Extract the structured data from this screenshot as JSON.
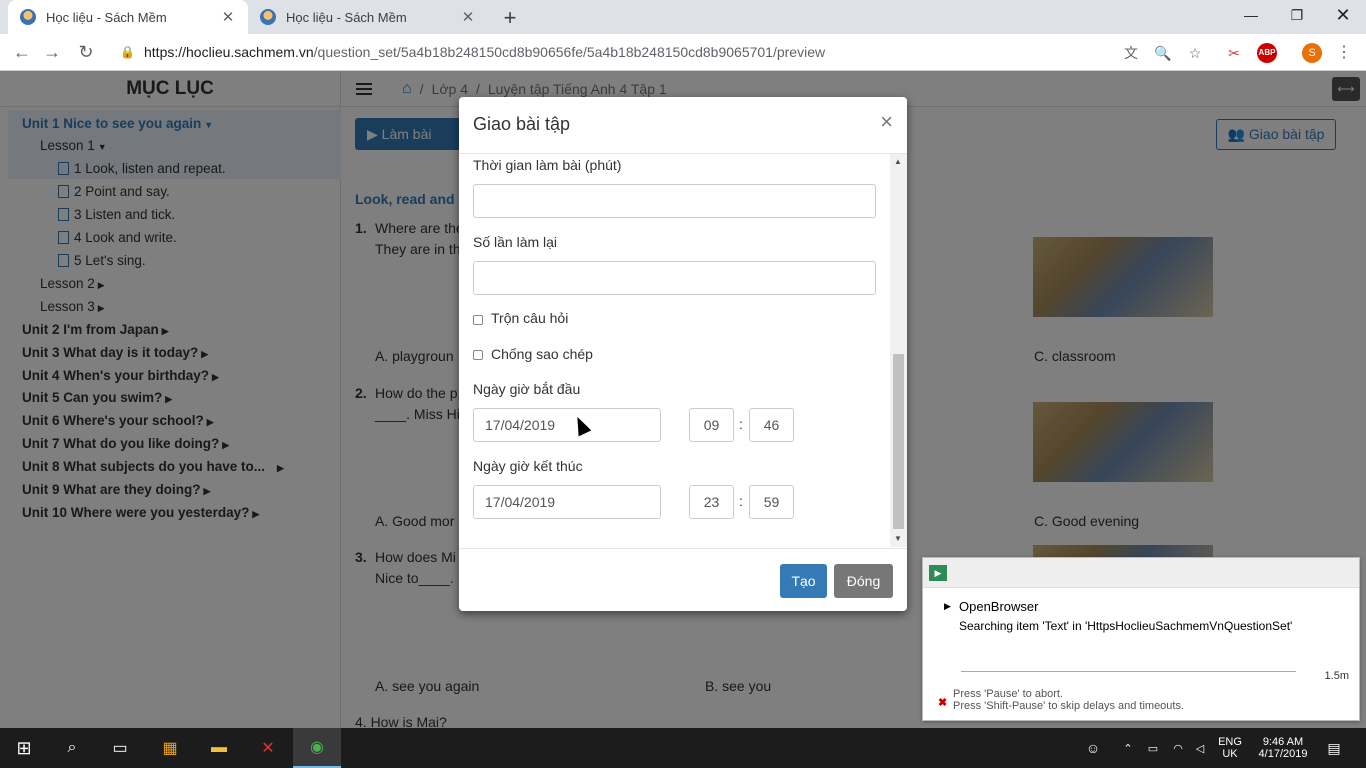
{
  "browser": {
    "tabs": [
      {
        "title": "Học liệu - Sách Mềm",
        "active": true
      },
      {
        "title": "Học liệu - Sách Mềm",
        "active": false
      }
    ],
    "url_host": "https://hoclieu.sachmem.vn",
    "url_path": "/question_set/5a4b18b248150cd8b90656fe/5a4b18b248150cd8b9065701/preview",
    "profile_initial": "S",
    "abp_label": "ABP"
  },
  "sidebar": {
    "title": "MỤC LỤC",
    "unit1": "Unit 1 Nice to see you again",
    "lesson1": "Lesson 1",
    "lesson1_items": [
      "1 Look, listen and repeat.",
      "2 Point and say.",
      "3 Listen and tick.",
      "4 Look and write.",
      "5 Let's sing."
    ],
    "lesson2": "Lesson 2",
    "lesson3": "Lesson 3",
    "units": [
      "Unit 2 I'm from Japan",
      "Unit 3 What day is it today?",
      "Unit 4 When's your birthday?",
      "Unit 5 Can you swim?",
      "Unit 6 Where's your school?",
      "Unit 7 What do you like doing?",
      "Unit 8 What subjects do you have to...",
      "Unit 9 What are they doing?",
      "Unit 10 Where were you yesterday?"
    ]
  },
  "main": {
    "breadcrumb": [
      "Lớp 4",
      "Luyện tập Tiếng Anh 4 Tập 1"
    ],
    "lam_bai": "Làm bài",
    "giao_bai_tap": "Giao bài tập",
    "heading": "Look, read and",
    "q1_num": "1.",
    "q1_line1": "Where are the",
    "q1_line2": "They are in th",
    "q1_a": "A. playgroun",
    "q1_c": "C. classroom",
    "q2_num": "2.",
    "q2_line1": "How do the p",
    "q2_line2": "____. Miss Hi",
    "q2_a": "A. Good mor",
    "q2_c": "C. Good evening",
    "q3_num": "3.",
    "q3_line1": "How does Mi",
    "q3_line2": "Nice to____.",
    "q3_a": "A. see you again",
    "q3_b": "B. see you",
    "q4": "4. How is Mai?"
  },
  "modal": {
    "title": "Giao bài tập",
    "close": "×",
    "time_label": "Thời gian làm bài (phút)",
    "time_value": "",
    "retry_label": "Số lần làm lại",
    "retry_value": "",
    "shuffle_label": "Trộn câu hỏi",
    "anticopy_label": "Chống sao chép",
    "start_label": "Ngày giờ bắt đầu",
    "start_date": "17/04/2019",
    "start_hour": "09",
    "start_minute": "46",
    "end_label": "Ngày giờ kết thúc",
    "end_date": "17/04/2019",
    "end_hour": "23",
    "end_minute": "59",
    "colon": ":",
    "create": "Tạo",
    "closebtn": "Đóng"
  },
  "ranorex": {
    "title": "OpenBrowser",
    "subtitle": "Searching item 'Text' in 'HttpsHoclieuSachmemVnQuestionSet'",
    "time": "1.5m",
    "hint1": "Press 'Pause' to abort.",
    "hint2": "Press 'Shift-Pause' to skip delays and timeouts."
  },
  "taskbar": {
    "lang1": "ENG",
    "lang2": "UK",
    "time": "9:46 AM",
    "date": "4/17/2019"
  }
}
